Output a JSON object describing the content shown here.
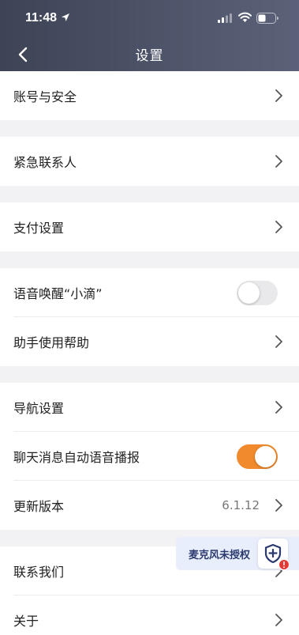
{
  "status_bar": {
    "time": "11:48"
  },
  "nav": {
    "title": "设置"
  },
  "groups": [
    {
      "items": [
        {
          "label": "账号与安全",
          "type": "link"
        }
      ]
    },
    {
      "items": [
        {
          "label": "紧急联系人",
          "type": "link"
        }
      ]
    },
    {
      "items": [
        {
          "label": "支付设置",
          "type": "link"
        }
      ]
    },
    {
      "items": [
        {
          "label": "语音唤醒“小滴”",
          "type": "toggle",
          "on": false
        },
        {
          "label": "助手使用帮助",
          "type": "link"
        }
      ]
    },
    {
      "items": [
        {
          "label": "导航设置",
          "type": "link"
        },
        {
          "label": "聊天消息自动语音播报",
          "type": "toggle",
          "on": true
        },
        {
          "label": "更新版本",
          "type": "link",
          "value": "6.1.12"
        }
      ]
    },
    {
      "items": [
        {
          "label": "联系我们",
          "type": "link"
        },
        {
          "label": "关于",
          "type": "link"
        }
      ]
    }
  ],
  "mic_banner": {
    "text": "麦克风未授权"
  },
  "colors": {
    "header_start": "#3e4456",
    "header_end": "#5b6178",
    "toggle_on": "#f08a2c",
    "background": "#f2f2f4",
    "alert": "#e53935",
    "shield": "#2b3a6e"
  },
  "icons": [
    "location-arrow-icon",
    "signal-icon",
    "wifi-icon",
    "battery-icon",
    "back-chevron-icon",
    "chevron-right-icon",
    "shield-plus-icon",
    "alert-badge-icon"
  ]
}
